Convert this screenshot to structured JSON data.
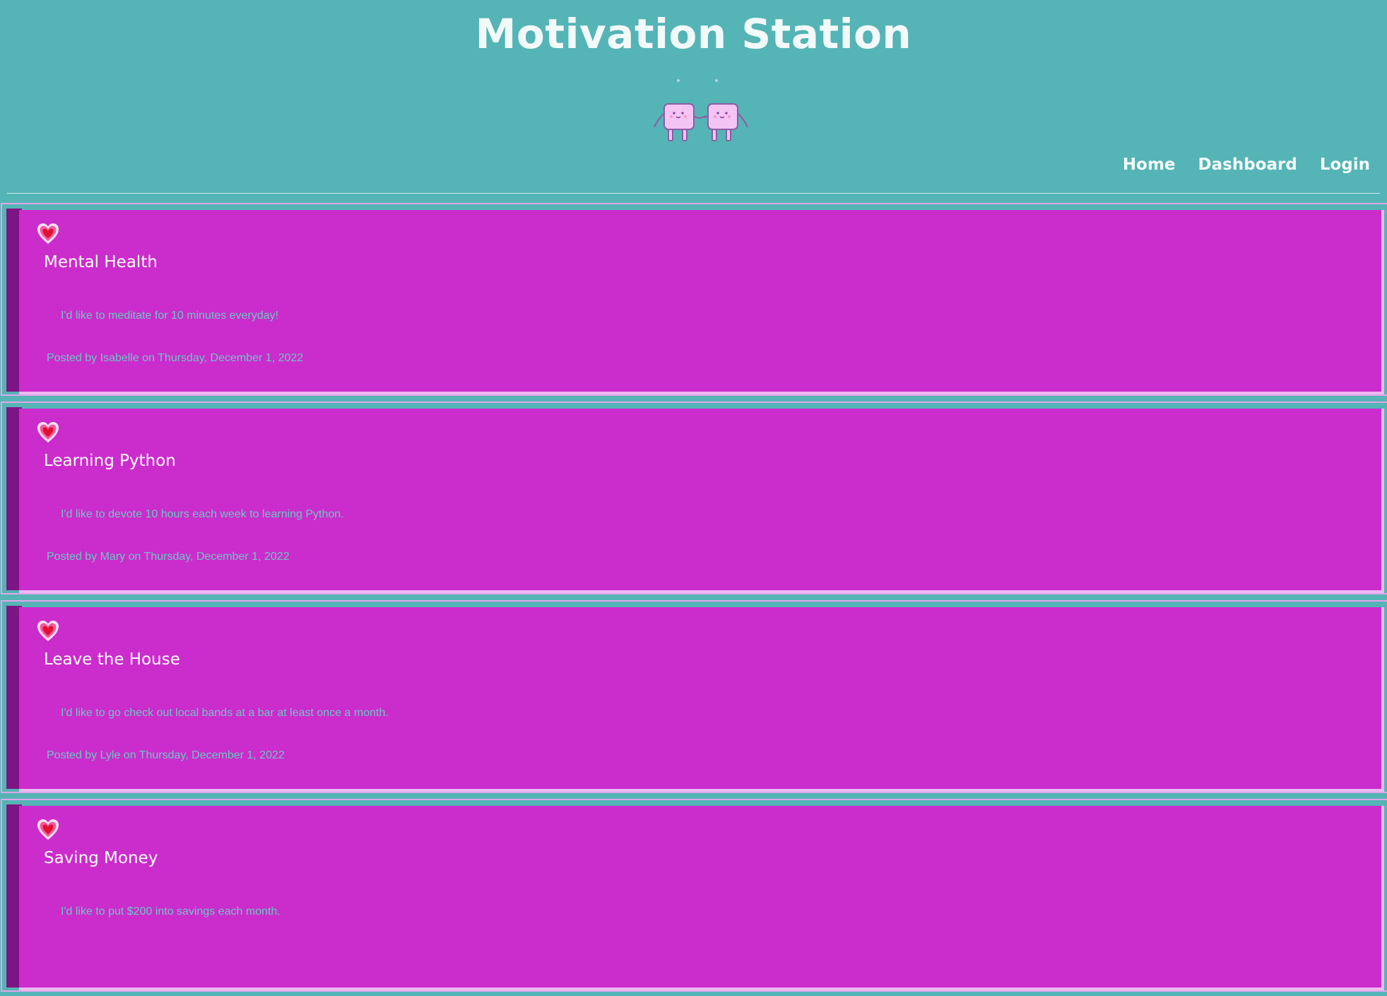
{
  "site": {
    "title": "Motivation Station"
  },
  "nav": {
    "items": [
      {
        "label": "Home"
      },
      {
        "label": "Dashboard"
      },
      {
        "label": "Login"
      }
    ]
  },
  "icons": {
    "like": "heart-icon",
    "mascot": "holding-hands-mascot"
  },
  "colors": {
    "page_background": "#55b4b5",
    "card_background": "#cb2ccc",
    "card_accent": "#7d1584",
    "muted_text": "#6ec6c3",
    "title_text": "#f2faf9"
  },
  "posts": [
    {
      "title": "Mental Health",
      "text": "I'd like to meditate for 10 minutes everyday!",
      "meta": "Posted by Isabelle on Thursday, December 1, 2022"
    },
    {
      "title": "Learning Python",
      "text": "I'd like to devote 10 hours each week to learning Python.",
      "meta": "Posted by Mary on Thursday, December 1, 2022"
    },
    {
      "title": "Leave the House",
      "text": "I'd like to go check out local bands at a bar at least once a month.",
      "meta": "Posted by Lyle on Thursday, December 1, 2022"
    },
    {
      "title": "Saving Money",
      "text": "I'd like to put $200 into savings each month.",
      "meta": ""
    }
  ]
}
